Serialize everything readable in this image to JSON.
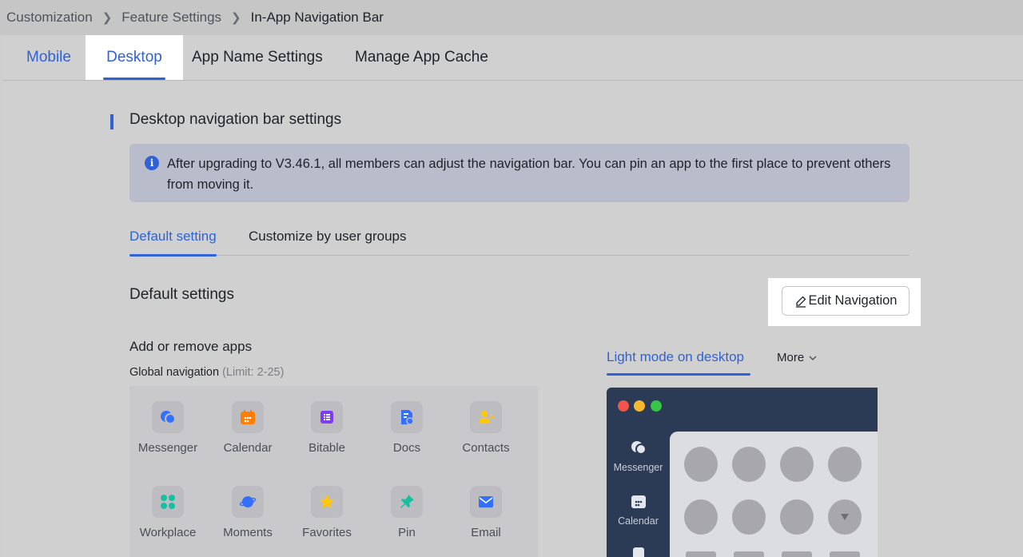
{
  "breadcrumb": {
    "items": [
      "Customization",
      "Feature Settings",
      "In-App Navigation Bar"
    ]
  },
  "tabs": {
    "mobile": "Mobile",
    "desktop": "Desktop",
    "app_name": "App Name Settings",
    "cache": "Manage App Cache"
  },
  "section": {
    "title": "Desktop navigation bar settings",
    "info": "After upgrading to V3.46.1, all members can adjust the navigation bar. You can pin an app to the first place to prevent others from moving it."
  },
  "subtabs": {
    "default": "Default setting",
    "custom": "Customize by user groups"
  },
  "default_settings": {
    "title": "Default settings",
    "edit_button": "Edit Navigation",
    "add_title": "Add or remove apps",
    "global_label": "Global navigation",
    "limit": "(Limit: 2-25)"
  },
  "apps": [
    {
      "label": "Messenger",
      "icon": "messenger-icon",
      "color": "#3370ff"
    },
    {
      "label": "Calendar",
      "icon": "calendar-icon",
      "color": "#ff7d00"
    },
    {
      "label": "Bitable",
      "icon": "bitable-icon",
      "color": "#7f3bf5"
    },
    {
      "label": "Docs",
      "icon": "docs-icon",
      "color": "#3370ff"
    },
    {
      "label": "Contacts",
      "icon": "contacts-icon",
      "color": "#ffc60a"
    },
    {
      "label": "Workplace",
      "icon": "workplace-icon",
      "color": "#14c0a0"
    },
    {
      "label": "Moments",
      "icon": "moments-icon",
      "color": "#3370ff"
    },
    {
      "label": "Favorites",
      "icon": "favorites-icon",
      "color": "#ffc60a"
    },
    {
      "label": "Pin",
      "icon": "pin-icon",
      "color": "#14c0a0"
    },
    {
      "label": "Email",
      "icon": "email-icon",
      "color": "#3370ff"
    }
  ],
  "preview": {
    "tab": "Light mode on desktop",
    "more": "More",
    "sidebar": [
      "Messenger",
      "Calendar"
    ]
  },
  "colors": {
    "accent": "#2f62d6",
    "info_bg": "#b8bccb",
    "preview_dark": "#2b3a55"
  }
}
